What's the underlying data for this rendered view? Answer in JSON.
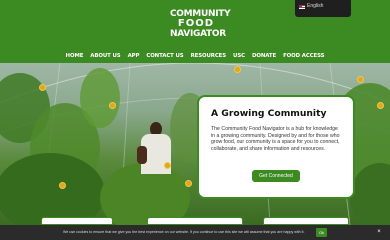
{
  "brand": {
    "line1": "COMMUNITY",
    "line2": "FOOD",
    "line3": "NAVIGATOR"
  },
  "nav": {
    "items": [
      "HOME",
      "ABOUT US",
      "APP",
      "CONTACT US",
      "RESOURCES",
      "USC",
      "DONATE",
      "FOOD ACCESS"
    ]
  },
  "language": {
    "label": "English",
    "flag_icon": "us-flag-icon"
  },
  "hero_card": {
    "title": "A Growing Community",
    "body": "The Community Food Navigator is a hub for knowledge in a growing community. Designed by and for those who grow food, our community is a space for you to connect, collaborate, and share information and resources.",
    "button": "Get Connected"
  },
  "cookie": {
    "message": "We use cookies to ensure that we give you the best experience on our website. If you continue to use this site we will assume that you are happy with it.",
    "ok": "Ok",
    "close": "×"
  },
  "colors": {
    "brand_green": "#3c8a22",
    "cookie_bg": "#2b2b2b"
  }
}
